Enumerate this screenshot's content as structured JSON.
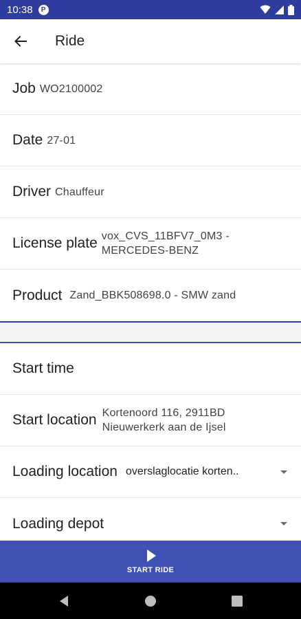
{
  "status_bar": {
    "time": "10:38",
    "app_icon_letter": "P"
  },
  "app_bar": {
    "title": "Ride"
  },
  "ride_info": [
    {
      "label": "Job",
      "value": "WO2100002"
    },
    {
      "label": "Date",
      "value": "27-01"
    },
    {
      "label": "Driver",
      "value": "Chauffeur"
    },
    {
      "label": "License plate",
      "value": "vox_CVS_11BFV7_0M3 - MERCEDES-BENZ"
    },
    {
      "label": "Product",
      "value": "Zand_BBK508698.0 - SMW zand"
    }
  ],
  "ride_fields": {
    "start_time": {
      "label": "Start time"
    },
    "start_location": {
      "label": "Start location",
      "value": "Kortenoord 116, 2911BD Nieuwerkerk aan de Ijsel"
    },
    "loading_location": {
      "label": "Loading location",
      "value": "overslaglocatie korten.."
    },
    "loading_depot": {
      "label": "Loading depot",
      "value": ""
    }
  },
  "action": {
    "label": "START RIDE"
  },
  "colors": {
    "primary": "#3f51b5",
    "primary_dark": "#2f3e9e",
    "nav_bar": "#000000"
  },
  "icons": [
    "back-arrow-icon",
    "play-icon",
    "wifi-icon",
    "signal-icon",
    "battery-icon",
    "nav-back-icon",
    "nav-home-icon",
    "nav-recents-icon"
  ]
}
